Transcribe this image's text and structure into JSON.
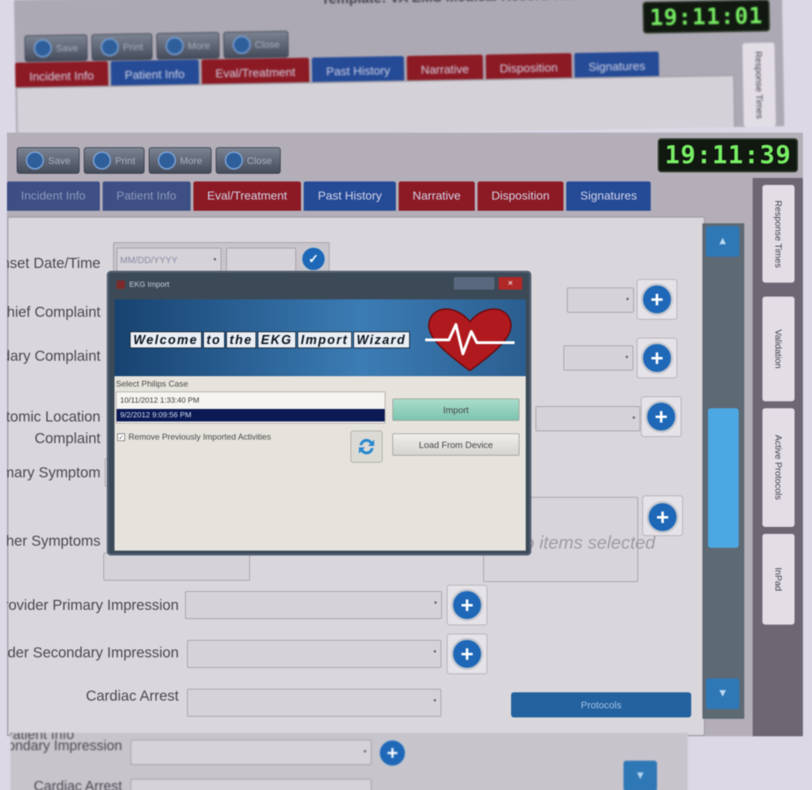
{
  "shotA": {
    "template_title": "Template: VA EMS Medical Record with ...",
    "clock": "19:11:01",
    "toolbar": [
      "Save",
      "Print",
      "More",
      "Close"
    ],
    "tabs": [
      {
        "label": "Incident Info",
        "style": "red"
      },
      {
        "label": "Patient Info",
        "style": "blue"
      },
      {
        "label": "Eval/Treatment",
        "style": "red"
      },
      {
        "label": "Past History",
        "style": "blue"
      },
      {
        "label": "Narrative",
        "style": "red"
      },
      {
        "label": "Disposition",
        "style": "red"
      },
      {
        "label": "Signatures",
        "style": "blue"
      }
    ],
    "sidebar_tab": "Response Times"
  },
  "shotB": {
    "clock": "19:11:39",
    "toolbar": [
      "Save",
      "Print",
      "More",
      "Close"
    ],
    "tabs": [
      {
        "label": "Incident Info",
        "style": "dk"
      },
      {
        "label": "Patient Info",
        "style": "dk"
      },
      {
        "label": "Eval/Treatment",
        "style": "red"
      },
      {
        "label": "Past History",
        "style": "blue"
      },
      {
        "label": "Narrative",
        "style": "red"
      },
      {
        "label": "Disposition",
        "style": "red"
      },
      {
        "label": "Signatures",
        "style": "blue"
      }
    ],
    "sidebar_tabs": [
      "Response Times",
      "Validation",
      "Active Protocols",
      "InPad"
    ],
    "form": {
      "onset_label": "Onset Date/Time",
      "date_placeholder": "MM/DD/YYYY",
      "chief_complaint": "Chief Complaint",
      "secondary_complaint": "Secondary Complaint",
      "anatomic_location": "Anatomic Location Complaint",
      "primary_symptom": "Primary Symptom",
      "other_symptoms": "Other Symptoms",
      "items_selected": "No items selected",
      "provider_primary": "Provider Primary Impression",
      "provider_secondary": "Provider Secondary Impression",
      "cardiac_arrest": "Cardiac Arrest",
      "protocols_button": "Protocols"
    },
    "wizard": {
      "title": "EKG Import",
      "banner": [
        "Welcome",
        "to",
        "the",
        "EKG",
        "Import",
        "Wizard"
      ],
      "select_label": "Select Philips Case",
      "cases": [
        "10/11/2012 1:33:40 PM",
        "9/2/2012 9:09:56 PM"
      ],
      "selected_case": 1,
      "checkbox_label": "Remove Previously Imported Activities",
      "checkbox_checked": true,
      "import_button": "Import",
      "load_button": "Load From Device"
    }
  },
  "shotC": {
    "tab": "Patient Info",
    "impression": "Provider Secondary Impression",
    "cardiac": "Cardiac Arrest"
  }
}
